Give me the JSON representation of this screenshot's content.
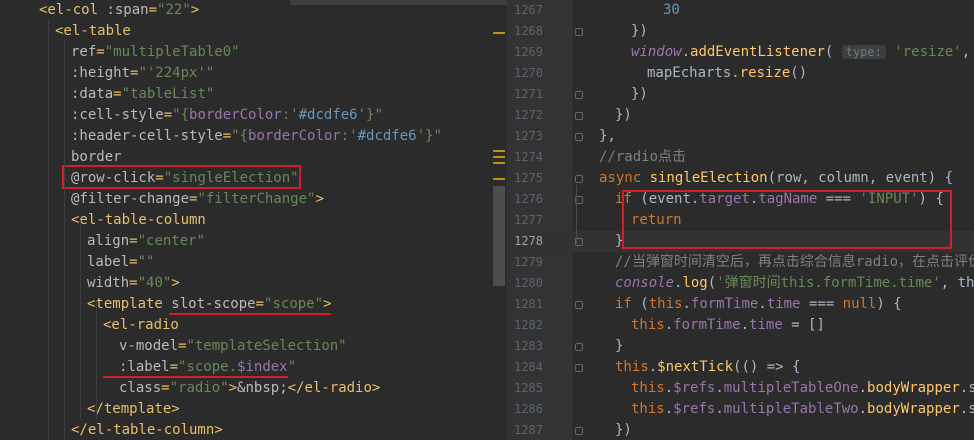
{
  "left": {
    "lines": [
      [
        [
          "tag",
          "<el-col "
        ],
        [
          "attr",
          ":span"
        ],
        [
          "tag",
          "="
        ],
        [
          "str",
          "\"22\""
        ],
        [
          "tag",
          ">"
        ]
      ],
      [
        [
          "tag",
          "<el-table"
        ]
      ],
      [
        [
          "attr",
          "ref"
        ],
        [
          "tag",
          "="
        ],
        [
          "str",
          "\"multipleTable0\""
        ]
      ],
      [
        [
          "attr",
          ":height"
        ],
        [
          "tag",
          "="
        ],
        [
          "str",
          "\"'224px'\""
        ]
      ],
      [
        [
          "attr",
          ":data"
        ],
        [
          "tag",
          "="
        ],
        [
          "str",
          "\"tableList\""
        ]
      ],
      [
        [
          "attr",
          ":cell-style"
        ],
        [
          "tag",
          "="
        ],
        [
          "str",
          "\"{"
        ],
        [
          "prop",
          "borderColor"
        ],
        [
          "str",
          ":'"
        ],
        [
          "num-lit",
          "#dcdfe6"
        ],
        [
          "str",
          "'}\""
        ]
      ],
      [
        [
          "attr",
          ":header-cell-style"
        ],
        [
          "tag",
          "="
        ],
        [
          "str",
          "\"{"
        ],
        [
          "prop",
          "borderColor"
        ],
        [
          "str",
          ":'"
        ],
        [
          "num-lit",
          "#dcdfe6"
        ],
        [
          "str",
          "'}\""
        ]
      ],
      [
        [
          "attr",
          "border"
        ]
      ],
      [
        [
          "attr",
          "@row-click"
        ],
        [
          "tag",
          "="
        ],
        [
          "str",
          "\"singleElection\""
        ]
      ],
      [
        [
          "attr",
          "@filter-change"
        ],
        [
          "tag",
          "="
        ],
        [
          "str",
          "\"filterChange\""
        ],
        [
          "tag",
          ">"
        ]
      ],
      [
        [
          "tag",
          "<el-table-column"
        ]
      ],
      [
        [
          "attr",
          "align"
        ],
        [
          "tag",
          "="
        ],
        [
          "str",
          "\"center\""
        ]
      ],
      [
        [
          "attr",
          "label"
        ],
        [
          "tag",
          "="
        ],
        [
          "str",
          "\"\""
        ]
      ],
      [
        [
          "attr",
          "width"
        ],
        [
          "tag",
          "="
        ],
        [
          "str",
          "\"40\""
        ],
        [
          "tag",
          ">"
        ]
      ],
      [
        [
          "tag",
          "<template "
        ],
        [
          "attr",
          "slot-scope"
        ],
        [
          "tag",
          "="
        ],
        [
          "str",
          "\"scope\""
        ],
        [
          "tag",
          ">"
        ]
      ],
      [
        [
          "tag",
          "<el-radio"
        ]
      ],
      [
        [
          "attr",
          "v-model"
        ],
        [
          "tag",
          "="
        ],
        [
          "str",
          "\"templateSelection\""
        ]
      ],
      [
        [
          "attr",
          ":label"
        ],
        [
          "tag",
          "="
        ],
        [
          "str",
          "\"scope."
        ],
        [
          "prop",
          "$index"
        ],
        [
          "str",
          "\""
        ]
      ],
      [
        [
          "attr",
          "class"
        ],
        [
          "tag",
          "="
        ],
        [
          "str",
          "\"radio\""
        ],
        [
          "tag",
          ">"
        ],
        [
          "attr",
          "&nbsp;"
        ],
        [
          "tag",
          "</el-radio>"
        ]
      ],
      [
        [
          "tag",
          "</template>"
        ]
      ],
      [
        [
          "tag",
          "</el-table-column>"
        ]
      ]
    ],
    "indents": [
      0,
      1,
      2,
      2,
      2,
      2,
      2,
      2,
      2,
      2,
      2,
      3,
      3,
      3,
      3,
      4,
      5,
      5,
      5,
      3,
      2
    ]
  },
  "right": {
    "line_numbers": [
      "1267",
      "1268",
      "1269",
      "1270",
      "1271",
      "1272",
      "1273",
      "1274",
      "1275",
      "1276",
      "1277",
      "1278",
      "1279",
      "1280",
      "1281",
      "1282",
      "1283",
      "1284",
      "1285",
      "1286",
      "1287"
    ],
    "current_line": "1278",
    "lines": [
      [
        [
          "num-lit",
          "30"
        ]
      ],
      [
        [
          "plain",
          "})"
        ]
      ],
      [
        [
          "glob",
          "window"
        ],
        [
          "plain",
          "."
        ],
        [
          "fn",
          "addEventListener"
        ],
        [
          "plain",
          "( "
        ],
        [
          "hint",
          "type:"
        ],
        [
          "plain",
          " "
        ],
        [
          "str",
          "'resize'"
        ],
        [
          "plain",
          ",  "
        ]
      ],
      [
        [
          "plain",
          "mapEcharts."
        ],
        [
          "fn",
          "resize"
        ],
        [
          "plain",
          "()"
        ]
      ],
      [
        [
          "plain",
          "})"
        ]
      ],
      [
        [
          "plain",
          "})"
        ]
      ],
      [
        [
          "plain",
          "},"
        ]
      ],
      [
        [
          "cmt",
          "//radio点击"
        ]
      ],
      [
        [
          "kw",
          "async "
        ],
        [
          "fn",
          "singleElection"
        ],
        [
          "plain",
          "(row, column, event) {"
        ]
      ],
      [
        [
          "kw",
          "if "
        ],
        [
          "plain",
          "(event."
        ],
        [
          "prop",
          "target"
        ],
        [
          "plain",
          "."
        ],
        [
          "prop",
          "tagName"
        ],
        [
          "plain",
          " === "
        ],
        [
          "str",
          "'INPUT'"
        ],
        [
          "plain",
          ") {"
        ]
      ],
      [
        [
          "kw",
          "return"
        ]
      ],
      [
        [
          "plain",
          "}"
        ]
      ],
      [
        [
          "cmt",
          "//当弹窗时间清空后，再点击综合信息radio，在点击评价"
        ]
      ],
      [
        [
          "glob",
          "console"
        ],
        [
          "plain",
          "."
        ],
        [
          "fn",
          "log"
        ],
        [
          "plain",
          "("
        ],
        [
          "str",
          "'弹窗时间this.formTime.time'"
        ],
        [
          "plain",
          ", thi"
        ]
      ],
      [
        [
          "kw",
          "if "
        ],
        [
          "plain",
          "("
        ],
        [
          "kw",
          "this"
        ],
        [
          "plain",
          "."
        ],
        [
          "prop",
          "formTime"
        ],
        [
          "plain",
          "."
        ],
        [
          "prop",
          "time"
        ],
        [
          "plain",
          " === "
        ],
        [
          "kw",
          "null"
        ],
        [
          "plain",
          ") {"
        ]
      ],
      [
        [
          "kw",
          "this"
        ],
        [
          "plain",
          "."
        ],
        [
          "prop",
          "formTime"
        ],
        [
          "plain",
          "."
        ],
        [
          "prop",
          "time"
        ],
        [
          "plain",
          " = []"
        ]
      ],
      [
        [
          "plain",
          "}"
        ]
      ],
      [
        [
          "kw",
          "this"
        ],
        [
          "plain",
          "."
        ],
        [
          "fn",
          "$nextTick"
        ],
        [
          "plain",
          "(() => {"
        ]
      ],
      [
        [
          "kw",
          "this"
        ],
        [
          "plain",
          "."
        ],
        [
          "prop",
          "$refs"
        ],
        [
          "plain",
          "."
        ],
        [
          "prop",
          "multipleTableOne"
        ],
        [
          "plain",
          "."
        ],
        [
          "fn",
          "bodyWrapper"
        ],
        [
          "plain",
          ".s"
        ]
      ],
      [
        [
          "kw",
          "this"
        ],
        [
          "plain",
          "."
        ],
        [
          "prop",
          "$refs"
        ],
        [
          "plain",
          "."
        ],
        [
          "prop",
          "multipleTableTwo"
        ],
        [
          "plain",
          "."
        ],
        [
          "fn",
          "bodyWrapper"
        ],
        [
          "plain",
          ".s"
        ]
      ],
      [
        [
          "plain",
          "})"
        ]
      ]
    ],
    "indents": [
      8,
      6,
      6,
      7,
      6,
      5,
      4,
      4,
      4,
      5,
      6,
      5,
      5,
      5,
      5,
      6,
      5,
      5,
      6,
      6,
      5
    ]
  }
}
